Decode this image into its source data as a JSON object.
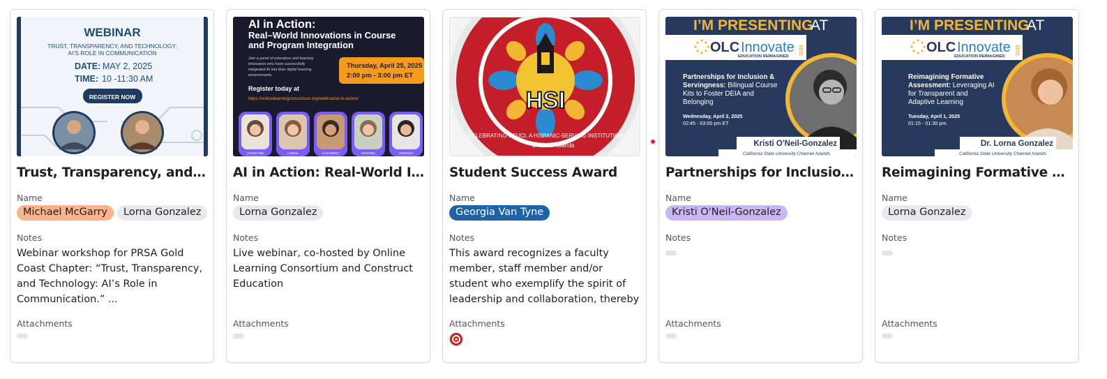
{
  "cards": [
    {
      "title": "Trust, Transparency, and Technology: AI's Role in Communication",
      "name_label": "Name",
      "names": [
        "Michael McGarry",
        "Lorna Gonzalez"
      ],
      "notes_label": "Notes",
      "notes": "Webinar workshop for PRSA Gold Coast Chapter: “Trust, Transparency, and Technology: AI’s Role in Communication.” ...",
      "attachments_label": "Attachments",
      "cover": {
        "heading": "WEBINAR",
        "subtitle_1": "TRUST, TRANSPARENCY, AND TECHNOLOGY:",
        "subtitle_2": "AI’S ROLE IN COMMUNICATION",
        "date_label": "DATE:",
        "date": "MAY 2, 2025",
        "time_label": "TIME:",
        "time": "10 -11:30 AM",
        "button": "REGISTER NOW"
      }
    },
    {
      "title": "AI in Action: Real-World Innovations in Course and Program Integration",
      "name_label": "Name",
      "names": [
        "Lorna Gonzalez"
      ],
      "notes_label": "Notes",
      "notes": "Live webinar, co-hosted by Online Learning Consortium and Construct Education",
      "attachments_label": "Attachments",
      "cover": {
        "heading": "AI in Action:",
        "sub_1": "Real–World Innovations in Course",
        "sub_2": "and Program Integration",
        "blurb": "Join a panel of educators and learning innovators who have successfully integrated AI into their digital learning environments.",
        "date": "Thursday, April 25, 2025",
        "time": "2:00 pm - 3:00 pm ET",
        "register": "Register today at",
        "url": "https://onlinelearningconsortium.org/webinar/ai-in-action/",
        "panelists": [
          "CHRISTINE",
          "LORNA",
          "CASANDRA",
          "KRISTEN",
          "DOREEN"
        ]
      }
    },
    {
      "title": "Student Success Award",
      "name_label": "Name",
      "names": [
        "Georgia Van Tyne"
      ],
      "notes_label": "Notes",
      "notes": "This award recognizes a faculty member, staff member and/or student who exemplify the spirit of leadership and collaboration, thereby making an ...",
      "attachments_label": "Attachments",
      "cover": {
        "center": "HSI",
        "ring_text": "CELEBRATING CSUCI, A HISPANIC-SERVING INSTITUTION",
        "footer": "Channel Islands"
      }
    },
    {
      "title": "Partnerships for Inclusion & Servingness: Bilingual Course Kits",
      "name_label": "Name",
      "names": [
        "Kristi O'Neil-Gonzalez"
      ],
      "notes_label": "Notes",
      "notes": "",
      "attachments_label": "Attachments",
      "cover": {
        "banner_a": "I’M PRESENTING",
        "banner_b": "AT",
        "olc_a": "OLC Innovate",
        "olc_b": "EDUCATION REIMAGINED",
        "olc_year": "2025",
        "session_bold": "Partnerships for Inclusion & Servingness:",
        "session_rest": "Bilingual Course Kits to Foster DEIA and Belonging",
        "date": "Wednesday, April 2, 2025",
        "time": "02:45 - 03:00 pm ET",
        "presenter": "Kristi O'Neil-Gonzalez",
        "institution": "California State University Channel Islands"
      }
    },
    {
      "title": "Reimagining Formative Assessment: Leveraging AI",
      "name_label": "Name",
      "names": [
        "Lorna Gonzalez"
      ],
      "notes_label": "Notes",
      "notes": "",
      "attachments_label": "Attachments",
      "cover": {
        "banner_a": "I’M PRESENTING",
        "banner_b": "AT",
        "olc_a": "OLC Innovate",
        "olc_b": "EDUCATION REIMAGINED",
        "olc_year": "2025",
        "session_bold": "Reimagining Formative Assessment:",
        "session_rest": "Leveraging AI for Transparent and Adaptive Learning",
        "date": "Tuesday, April 1, 2025",
        "time": "01:15 - 01:30 pm.",
        "presenter": "Dr. Lorna Gonzalez",
        "institution": "California State University Channel Islands"
      }
    }
  ],
  "colors": {
    "pill_orange": "#f9b38d",
    "pill_gray": "#e7e9ec",
    "pill_blue": "#1d63a6",
    "pill_purple": "#c9b6f2",
    "olc_navy": "#27395c",
    "olc_gold": "#f2b632"
  }
}
